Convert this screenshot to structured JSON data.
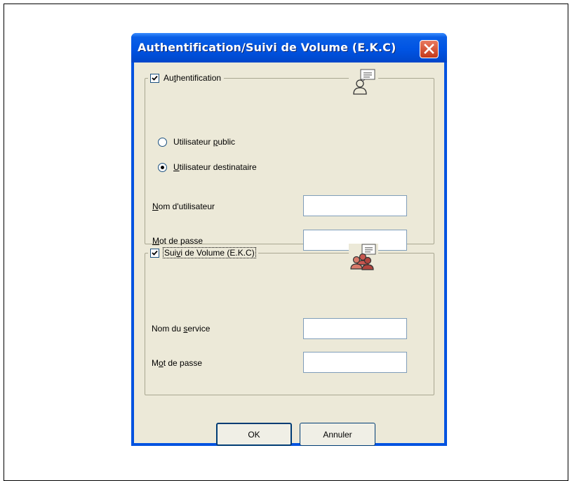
{
  "dialog": {
    "title": "Authentification/Suivi de Volume (E.K.C)"
  },
  "auth_group": {
    "checkbox_checked": true,
    "label_pre": "Au",
    "label_ul": "t",
    "label_post": "hentification",
    "radio_public": {
      "label_pre": "Utilisateur ",
      "label_ul": "p",
      "label_post": "ublic",
      "selected": false
    },
    "radio_dest": {
      "label_pre": "",
      "label_ul": "U",
      "label_post": "tilisateur destinataire",
      "selected": true
    },
    "username_label_ul": "N",
    "username_label_post": "om d'utilisateur",
    "username_value": "",
    "password_label_ul": "M",
    "password_label_post": "ot de passe",
    "password_value": "",
    "icon": "user-chat-icon"
  },
  "tracking_group": {
    "checkbox_checked": true,
    "label_pre": "Sui",
    "label_ul": "v",
    "label_post": "i de Volume (E.K.C)",
    "service_label_pre": "Nom du ",
    "service_label_ul": "s",
    "service_label_post": "ervice",
    "service_value": "",
    "password_label_pre": "M",
    "password_label_ul": "o",
    "password_label_post": "t de passe",
    "password_value": "",
    "icon": "group-chat-icon"
  },
  "buttons": {
    "ok": "OK",
    "cancel": "Annuler"
  },
  "colors": {
    "titlebar": "#0054e3",
    "client": "#ece9d8",
    "close_button": "#d9533a"
  }
}
